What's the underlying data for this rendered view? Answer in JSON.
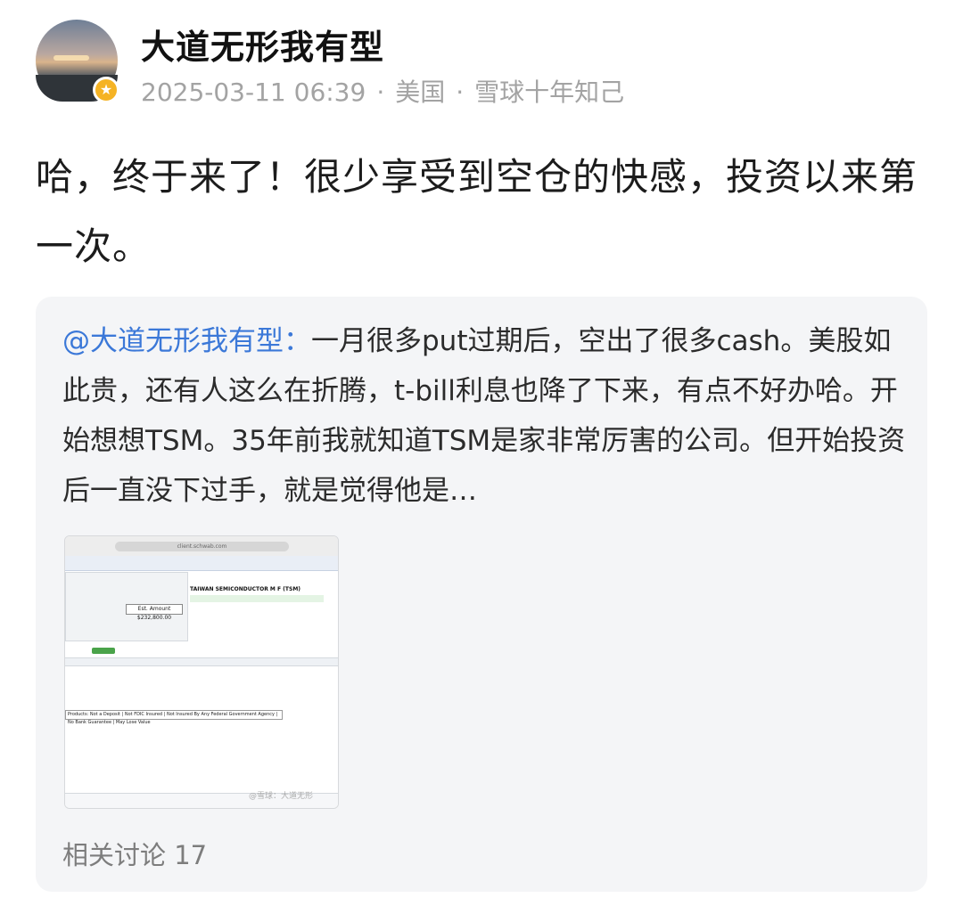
{
  "author": {
    "name": "大道无形我有型",
    "verified_badge": "★"
  },
  "meta": {
    "datetime": "2025-03-11 06:39",
    "location": "美国",
    "separator": "·",
    "source": "雪球十年知己"
  },
  "post": {
    "text": "哈，终于来了！很少享受到空仓的快感，投资以来第一次。"
  },
  "quote": {
    "mention": "@大道无形我有型：",
    "text": "一月很多put过期后，空出了很多cash。美股如此贵，还有人这么在折腾，t-bill利息也降了下来，有点不好办哈。开始想想TSM。35年前我就知道TSM是家非常厉害的公司。但开始投资后一直没下过手，就是觉得他是…",
    "image": {
      "url": "client.schwab.com",
      "ticker": "TAIWAN SEMICONDUCTOR M F (TSM)",
      "amount": "Est. Amount $232,800.00",
      "disclaimer": "Products: Not a Deposit | Not FDIC Insured | Not Insured By Any Federal Government Agency | No Bank Guarantee | May Lose Value",
      "watermark": "@雪球：大道无形"
    },
    "related": "相关讨论 17"
  },
  "colors": {
    "mention": "#3b78d8",
    "meta_gray": "#a3a3a3",
    "card_bg": "#f4f5f7",
    "badge": "#f5b324"
  }
}
